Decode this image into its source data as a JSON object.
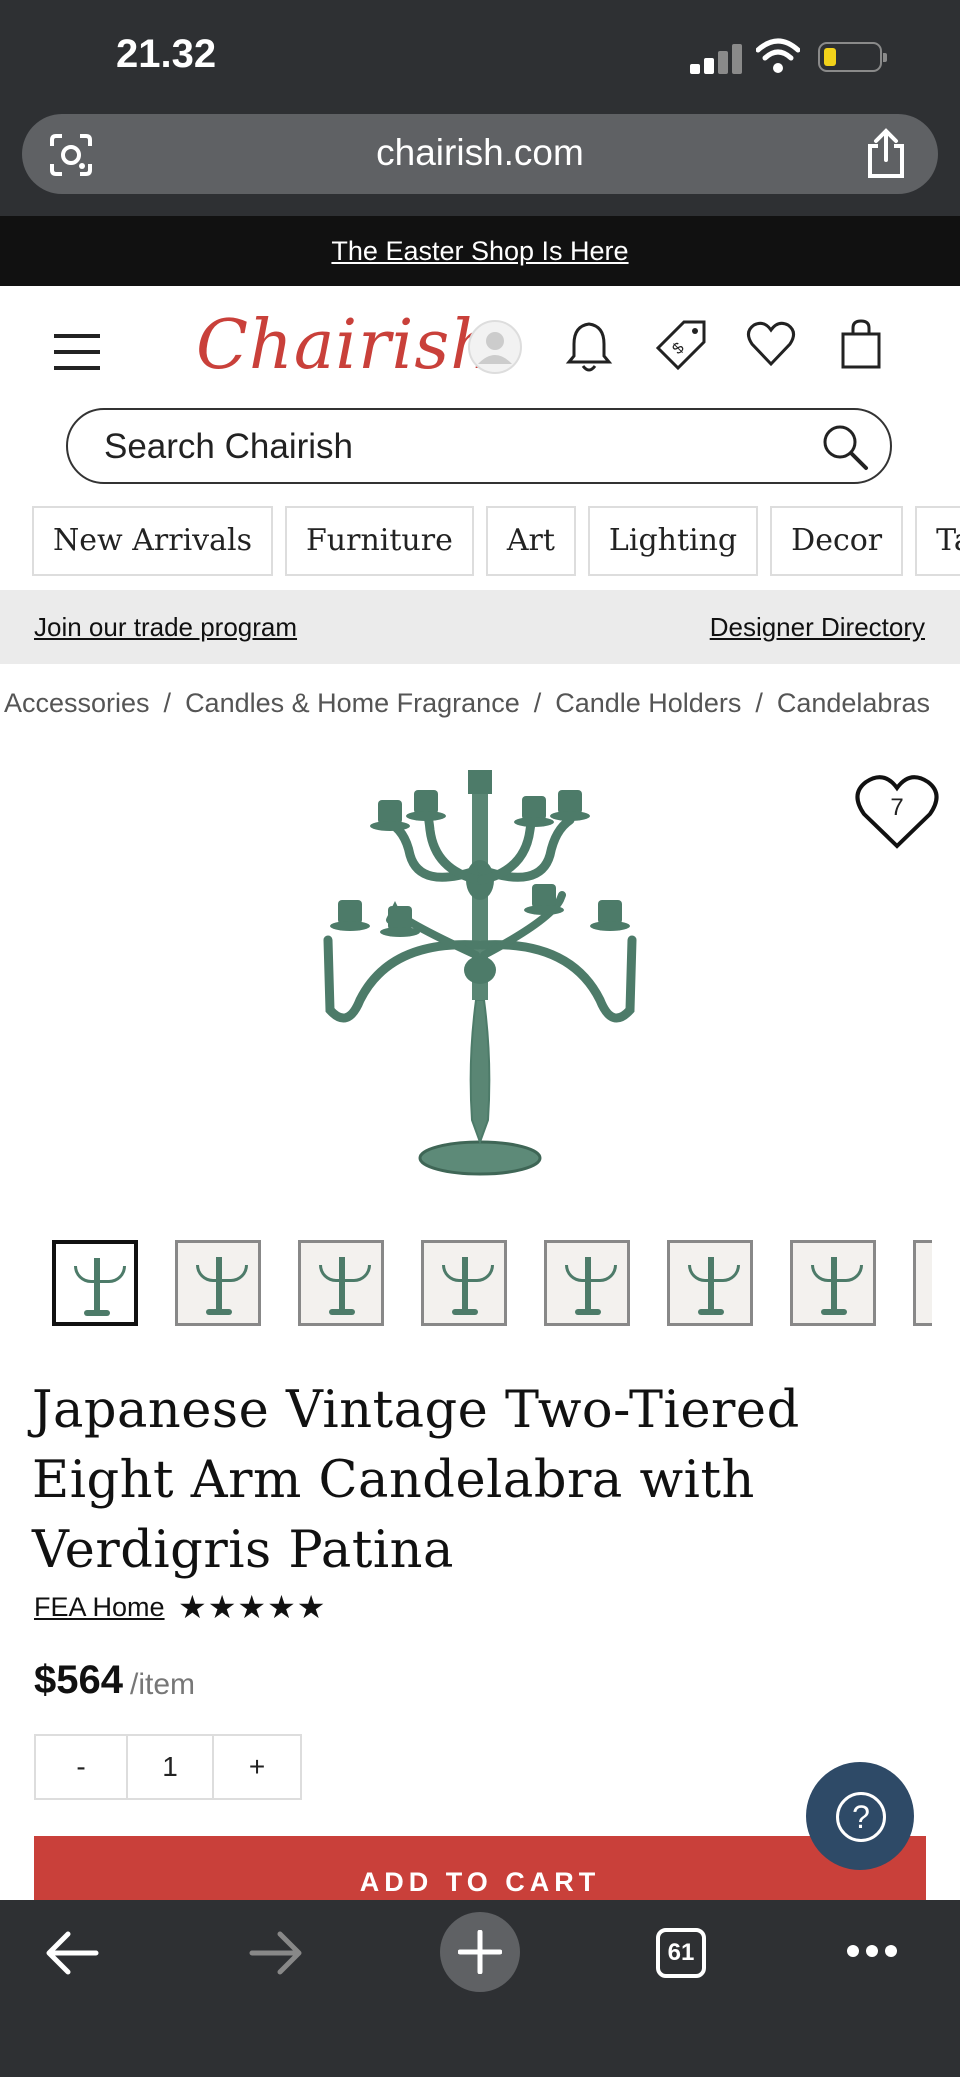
{
  "status_bar": {
    "time": "21.32"
  },
  "browser": {
    "url": "chairish.com",
    "tab_count": "61"
  },
  "promo": {
    "text": "The Easter Shop Is Here"
  },
  "header": {
    "logo": "Chairish",
    "search_placeholder": "Search Chairish"
  },
  "nav": {
    "categories": [
      "New Arrivals",
      "Furniture",
      "Art",
      "Lighting",
      "Decor",
      "Tabl"
    ]
  },
  "trade": {
    "join": "Join our trade program",
    "directory": "Designer Directory"
  },
  "breadcrumb": [
    "Accessories",
    "Candles & Home Fragrance",
    "Candle Holders",
    "Candelabras"
  ],
  "breadcrumb_sep": "/",
  "product": {
    "favorites": "7",
    "title": "Japanese Vintage Two-Tiered Eight Arm Candelabra with Verdigris Patina",
    "seller": "FEA Home",
    "rating_stars": "★★★★★",
    "price": "$564",
    "price_unit": "/item",
    "quantity": "1",
    "qty_minus": "-",
    "qty_plus": "+",
    "add_to_cart": "ADD TO CART",
    "help": "?"
  },
  "colors": {
    "brand_red": "#c9403a",
    "help_blue": "#2e4a67",
    "patina_green": "#4d7b69"
  }
}
